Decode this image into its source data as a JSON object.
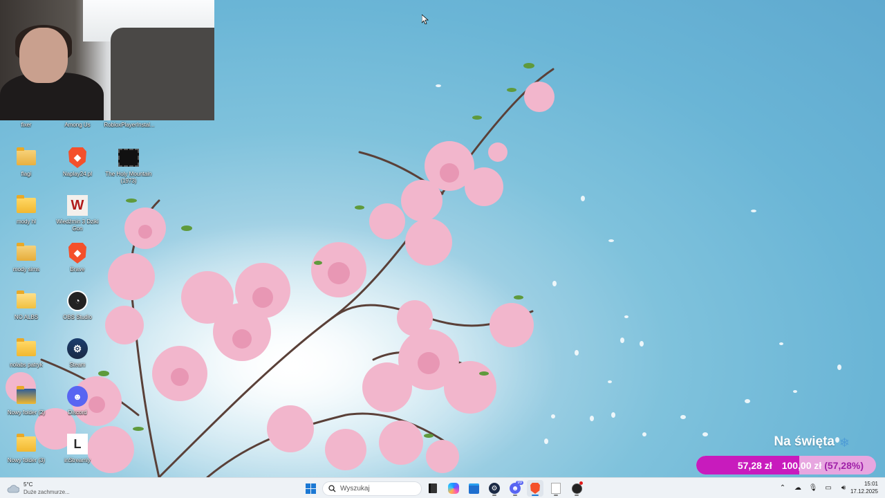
{
  "webcam": {
    "visible": true
  },
  "desktop_icons": [
    {
      "id": "fixer",
      "label": "fixer",
      "type": "label-only"
    },
    {
      "id": "among-us",
      "label": "Among Us",
      "type": "label-only"
    },
    {
      "id": "roblox",
      "label": "RobloxPlayerInstal...",
      "type": "label-only"
    },
    {
      "id": "flagi",
      "label": "flagi",
      "type": "folder-pics"
    },
    {
      "id": "naplay",
      "label": "Naplay24.pl",
      "type": "brave"
    },
    {
      "id": "holy-mountain",
      "label": "The Holy Mountain (1973)",
      "type": "video"
    },
    {
      "id": "mody-hl",
      "label": "mody hl",
      "type": "folder"
    },
    {
      "id": "wiedzmin",
      "label": "Wiedźmin 3 Dziki Gon",
      "type": "witcher"
    },
    {
      "id": "mody-sims",
      "label": "mody sims",
      "type": "folder-pics"
    },
    {
      "id": "brave",
      "label": "Brave",
      "type": "brave"
    },
    {
      "id": "no-alibis",
      "label": "NO ALBS",
      "type": "folder-doc"
    },
    {
      "id": "obs",
      "label": "OBS Studio",
      "type": "obs"
    },
    {
      "id": "nolabs",
      "label": "nolabs patryk",
      "type": "folder"
    },
    {
      "id": "steam",
      "label": "Steam",
      "type": "steam"
    },
    {
      "id": "nowy2",
      "label": "Nowy folder (2)",
      "type": "folder-dark"
    },
    {
      "id": "discord",
      "label": "Discord",
      "type": "discord"
    },
    {
      "id": "nowy3",
      "label": "Nowy folder (3)",
      "type": "folder"
    },
    {
      "id": "instreamly",
      "label": "inStreamly",
      "type": "instreamly"
    }
  ],
  "donation_goal": {
    "title": "Na święta",
    "snow_icon": "snowflake-icon",
    "current": "57,28 zł",
    "goal": "100,00 zł",
    "percent_label": "(57,28%)",
    "percent": 57.28,
    "colors": {
      "fill": "#c81bbd",
      "track": "#e7a6e0"
    }
  },
  "taskbar": {
    "weather": {
      "temp": "5°C",
      "desc": "Duże zachmurze..."
    },
    "search_placeholder": "Wyszukaj",
    "pinned": [
      "file-explorer-icon",
      "copilot-icon",
      "store-icon",
      "steam-icon",
      "discord-icon",
      "brave-icon",
      "notepad-icon",
      "obs-icon"
    ],
    "discord_badge": "99",
    "clock": {
      "time": "15:01",
      "date": "17.12.2025"
    }
  }
}
